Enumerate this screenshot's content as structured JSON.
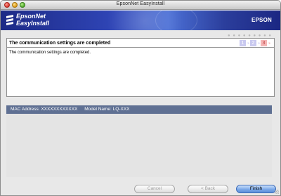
{
  "window": {
    "title": "EpsonNet EasyInstall"
  },
  "banner": {
    "product_line1": "EpsonNet",
    "product_line2": "EasyInstall",
    "brand": "EPSON",
    "dots": "● ● ● ● ● ● ● ● ●"
  },
  "panel": {
    "title": "The communication settings are completed",
    "message": "The communication settings are completed.",
    "steps": [
      "1",
      "2",
      "3"
    ],
    "step_arrows": "›››",
    "current_step": 3
  },
  "info": {
    "mac_address": "MAC Address: XXXXXXXXXXXX",
    "model_name": "Model Name: LQ-XXX"
  },
  "buttons": {
    "cancel": "Cancel",
    "back": "< Back",
    "finish": "Finish"
  },
  "colors": {
    "banner": "#2f45b6",
    "info_bar": "#5f7093",
    "default_button": "#7aa8e8"
  }
}
